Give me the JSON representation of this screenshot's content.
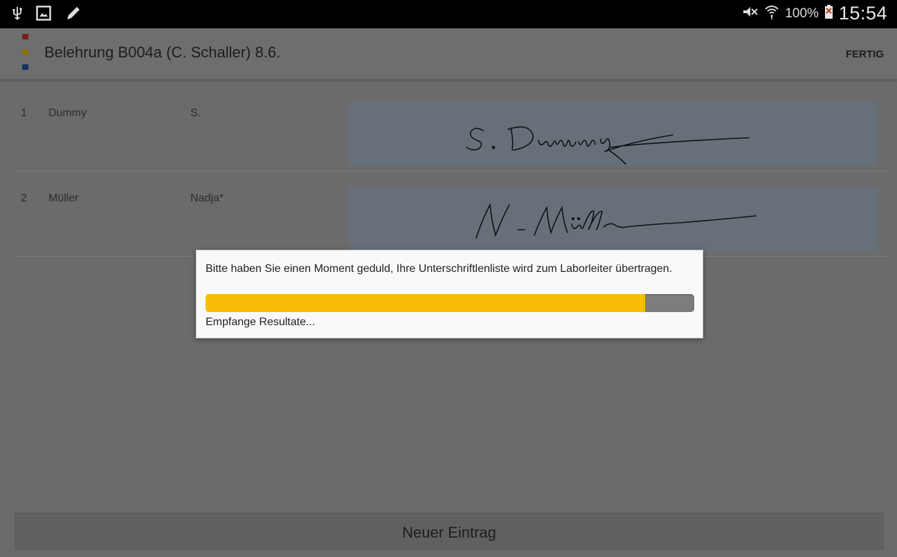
{
  "statusbar": {
    "battery_percent": "100%",
    "time": "15:54",
    "icons": [
      "usb-icon",
      "image-icon",
      "pen-icon",
      "mute-icon",
      "wifi-icon",
      "battery-icon"
    ]
  },
  "actionbar": {
    "title": "Belehrung B004a (C. Schaller) 8.6.",
    "action_label": "FERTIG",
    "logo_colors": [
      "#c0392b",
      "#e6b800",
      "#1f4e99"
    ]
  },
  "entries": [
    {
      "number": "1",
      "last_name": "Dummy",
      "first_name": "S."
    },
    {
      "number": "2",
      "last_name": "Müller",
      "first_name": "Nadja*"
    }
  ],
  "new_entry_label": "Neuer Eintrag",
  "dialog": {
    "message": "Bitte haben Sie einen Moment geduld, Ihre Unterschriftlenliste wird zum Laborleiter übertragen.",
    "progress": 0.9,
    "status": "Empfange Resultate..."
  },
  "colors": {
    "progress_fill": "#fbbc05",
    "signature_bg": "#dfe7f0",
    "overlay_dim": "#6b6b6b"
  }
}
